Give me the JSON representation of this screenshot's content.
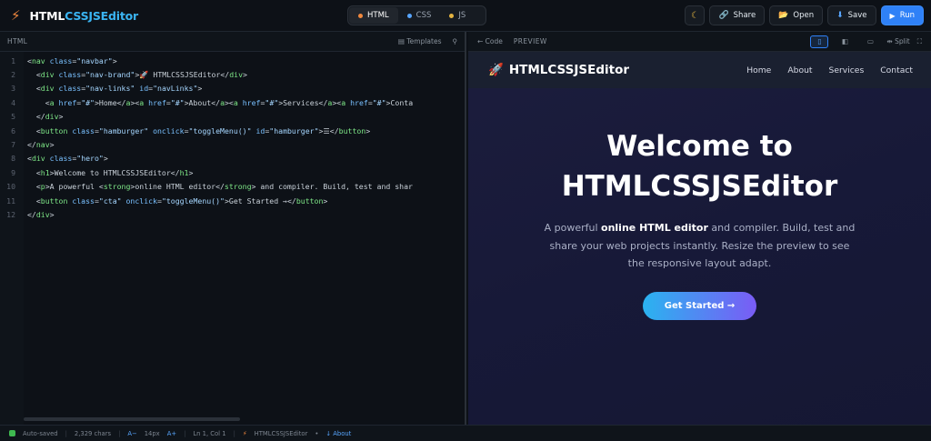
{
  "app": {
    "logo_part1": "HTML",
    "logo_part2": "CSSJSEditor",
    "logo_icon": "bolt-icon"
  },
  "lang_tabs": [
    {
      "label": "HTML",
      "color": "#f0883e",
      "active": true
    },
    {
      "label": "CSS",
      "color": "#58a6ff",
      "active": false
    },
    {
      "label": "JS",
      "color": "#e3b341",
      "active": false
    }
  ],
  "actions": {
    "theme_icon": "moon-icon",
    "share": "Share",
    "open": "Open",
    "save": "Save",
    "run": "Run"
  },
  "editor": {
    "title": "HTML",
    "templates": "Templates",
    "lines": [
      "1",
      "2",
      "3",
      "4",
      "5",
      "6",
      "7",
      "8",
      "9",
      "10",
      "11",
      "12"
    ]
  },
  "preview": {
    "back": "← Code",
    "title": "PREVIEW",
    "split": "Split"
  },
  "site": {
    "brand": "HTMLCSSJSEditor",
    "brand_icon": "🚀",
    "nav": [
      "Home",
      "About",
      "Services",
      "Contact"
    ],
    "hero_title": "Welcome to HTMLCSSJSEditor",
    "hero_p_before": "A powerful ",
    "hero_p_bold": "online HTML editor",
    "hero_p_after": " and compiler. Build, test and share your web projects instantly. Resize the preview to see the responsive layout adapt.",
    "cta": "Get Started →"
  },
  "status": {
    "autosaved": "Auto-saved",
    "chars": "2,329 chars",
    "font_minus": "A−",
    "font_size": "14px",
    "font_plus": "A+",
    "cursor": "Ln 1, Col 1",
    "app_link": "HTMLCSSJSEditor",
    "about": "↓ About"
  }
}
